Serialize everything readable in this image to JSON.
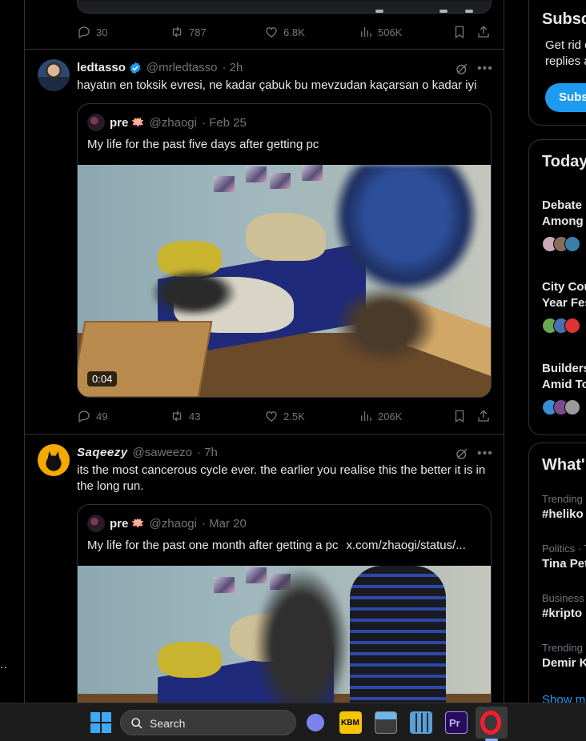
{
  "left_overflow_text": "..",
  "prev_tweet": {
    "stats": {
      "replies": "30",
      "reposts": "787",
      "likes": "6.8K",
      "views": "506K"
    }
  },
  "tweets": [
    {
      "name": "ledtasso",
      "handle": "@mrledtasso",
      "time": "· 2h",
      "text": "hayatın en toksik evresi, ne kadar çabuk bu mevzudan kaçarsan o kadar iyi",
      "quote": {
        "name": "pre",
        "emoji": "🪷",
        "handle": "@zhaogi",
        "time": "· Feb 25",
        "text": "My life for the past five days after getting pc",
        "link": "",
        "duration": "0:04"
      },
      "stats": {
        "replies": "49",
        "reposts": "43",
        "likes": "2.5K",
        "views": "206K"
      }
    },
    {
      "name": "Saqeezy",
      "handle": "@saweezo",
      "time": "· 7h",
      "text": "its the most cancerous cycle ever. the earlier you realise this the better it is in the long run.",
      "quote": {
        "name": "pre",
        "emoji": "🪷",
        "handle": "@zhaogi",
        "time": "· Mar 20",
        "text": "My life for the past one month after getting a pc",
        "link": "x.com/zhaogi/status/..."
      }
    }
  ],
  "sidebar": {
    "subscribe": {
      "title": "Subsc",
      "line1": "Get rid c",
      "line2": "replies a",
      "button": "Subsc"
    },
    "news": {
      "title": "Today",
      "items": [
        {
          "line1": "Debate",
          "line2": "Among"
        },
        {
          "line1": "City Cou",
          "line2": "Year Fes"
        },
        {
          "line1": "Builders",
          "line2": "Amid To"
        }
      ]
    },
    "trends": {
      "title": "What'",
      "items": [
        {
          "category": "Trending",
          "name": "#heliko"
        },
        {
          "category": "Politics · T",
          "name": "Tina Pet"
        },
        {
          "category": "Business",
          "name": "#kripto"
        },
        {
          "category": "Trending",
          "name": "Demir K"
        }
      ],
      "show_more": "Show m"
    }
  },
  "taskbar": {
    "search_label": "Search",
    "apps": [
      "start",
      "search",
      "meet",
      "kbm",
      "keyboard",
      "calculator",
      "premiere-pro",
      "opera"
    ],
    "kbm_label": "KBM",
    "pr_label": "Pr",
    "accent": "#1d9bf0"
  }
}
